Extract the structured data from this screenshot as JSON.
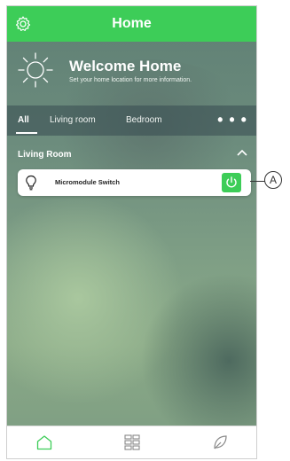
{
  "header": {
    "title": "Home"
  },
  "welcome": {
    "title": "Welcome Home",
    "subtitle": "Set your home location for more information."
  },
  "tabs": [
    {
      "label": "All"
    },
    {
      "label": "Living room"
    },
    {
      "label": "Bedroom"
    }
  ],
  "more_label": "• • •",
  "section": {
    "title": "Living Room"
  },
  "device": {
    "name": "Micromodule Switch"
  },
  "callout": {
    "label": "A"
  },
  "colors": {
    "accent": "#3dcd58"
  }
}
